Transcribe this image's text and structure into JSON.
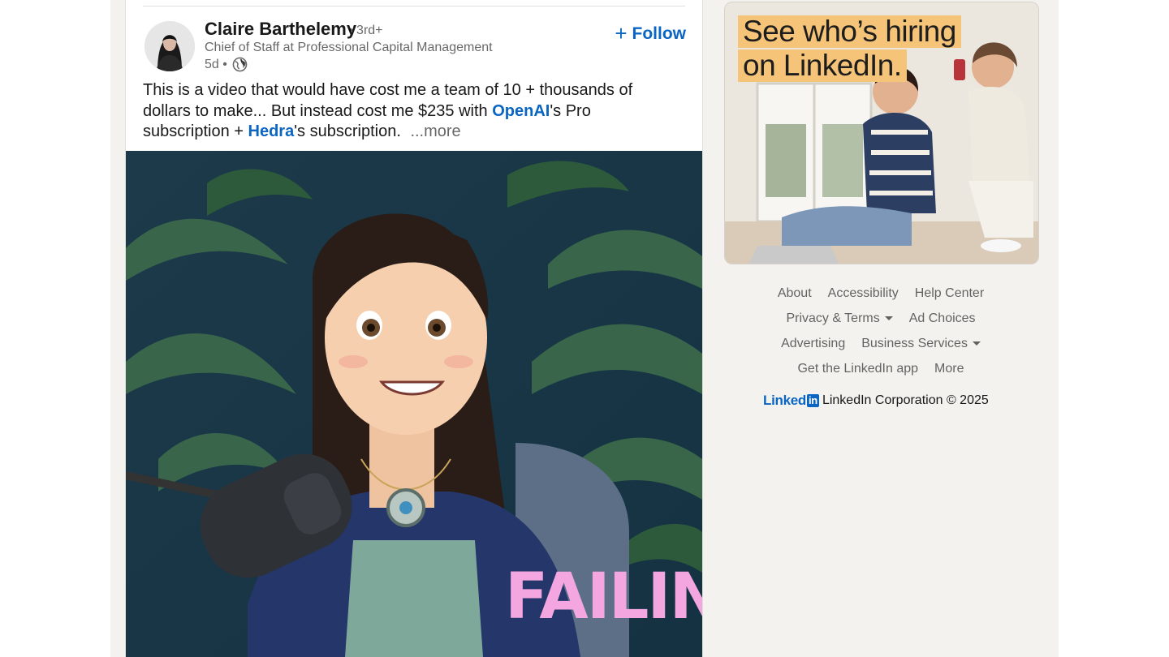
{
  "post": {
    "author": {
      "name": "Claire Barthelemy",
      "degree": "• 3rd+",
      "headline": "Chief of Staff at Professional Capital Management",
      "time": "5d •"
    },
    "follow_label": "Follow",
    "text_part1": "This is a video that would have cost me a team of 10 + thousands of dollars to make... But instead cost me $235 with ",
    "mention1": "OpenAI",
    "text_part2": "'s Pro subscription + ",
    "mention2": "Hedra",
    "text_part3": "'s subscription.",
    "see_more": "...more",
    "media_caption": "FAILING"
  },
  "ad": {
    "line1": "See who’s hiring",
    "line2": "on LinkedIn."
  },
  "footer": {
    "rows": [
      [
        "About",
        "Accessibility",
        "Help Center"
      ],
      [
        "Privacy & Terms",
        "Ad Choices"
      ],
      [
        "Advertising",
        "Business Services"
      ],
      [
        "Get the LinkedIn app",
        "More"
      ]
    ],
    "logo_text": "Linked",
    "logo_box": "in",
    "copyright": "LinkedIn Corporation © 2025"
  },
  "colors": {
    "accent": "#0a66c2",
    "page_bg": "#f4f2ee",
    "ad_highlight": "#f5c478",
    "caption": "#f3a6df"
  }
}
